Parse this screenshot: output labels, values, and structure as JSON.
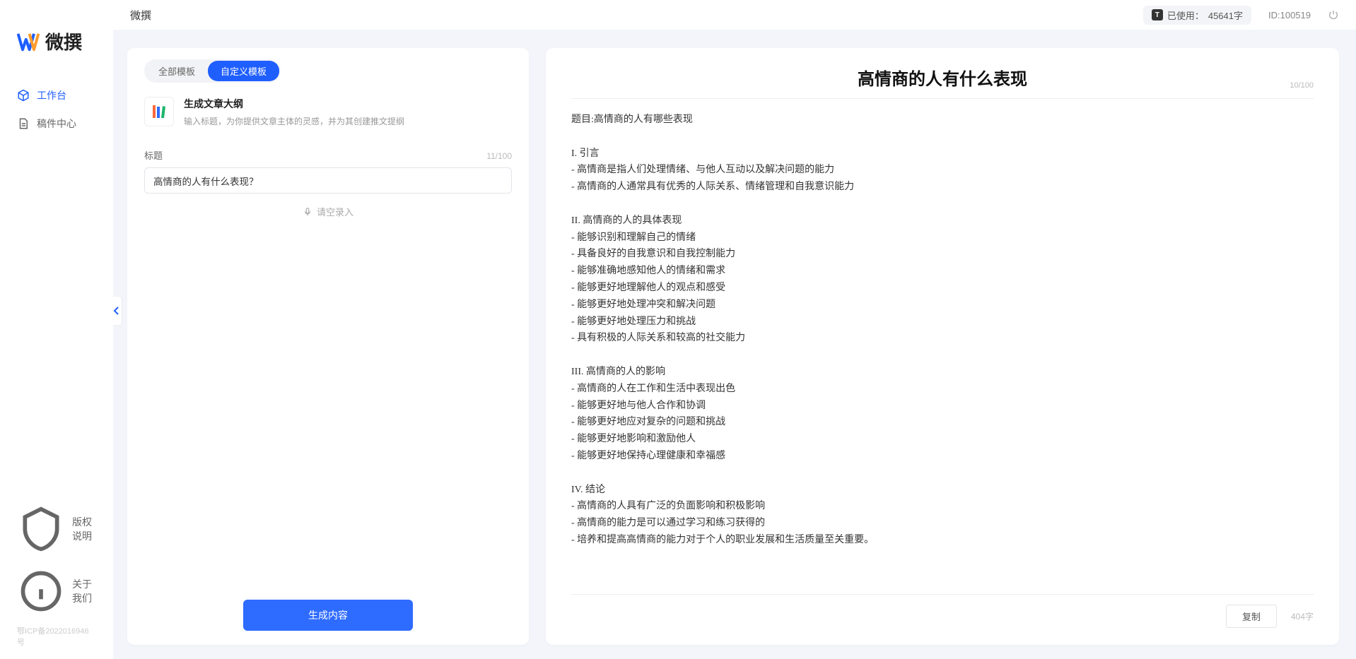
{
  "app": {
    "brand_text": "微撰",
    "icp": "鄂ICP备2022016946号"
  },
  "sidebar": {
    "items": [
      {
        "label": "工作台",
        "active": true
      },
      {
        "label": "稿件中心",
        "active": false
      }
    ],
    "footer": [
      {
        "label": "版权说明"
      },
      {
        "label": "关于我们"
      }
    ]
  },
  "topbar": {
    "title": "微撰",
    "usage_prefix": "已使用：",
    "usage_value": "45641字",
    "id_label": "ID:100519"
  },
  "left": {
    "tabs": [
      {
        "label": "全部模板",
        "active": false
      },
      {
        "label": "自定义模板",
        "active": true
      }
    ],
    "template": {
      "name": "生成文章大纲",
      "desc": "输入标题，为你提供文章主体的灵感，并为其创建推文提纲"
    },
    "field_label": "标题",
    "title_counter": "11/100",
    "title_value": "高情商的人有什么表现？",
    "voice_hint": "请空录入",
    "generate_label": "生成内容"
  },
  "right": {
    "title": "高情商的人有什么表现",
    "title_counter": "10/100",
    "body": "题目:高情商的人有哪些表现\n\nI. 引言\n- 高情商是指人们处理情绪、与他人互动以及解决问题的能力\n- 高情商的人通常具有优秀的人际关系、情绪管理和自我意识能力\n\nII. 高情商的人的具体表现\n- 能够识别和理解自己的情绪\n- 具备良好的自我意识和自我控制能力\n- 能够准确地感知他人的情绪和需求\n- 能够更好地理解他人的观点和感受\n- 能够更好地处理冲突和解决问题\n- 能够更好地处理压力和挑战\n- 具有积极的人际关系和较高的社交能力\n\nIII. 高情商的人的影响\n- 高情商的人在工作和生活中表现出色\n- 能够更好地与他人合作和协调\n- 能够更好地应对复杂的问题和挑战\n- 能够更好地影响和激励他人\n- 能够更好地保持心理健康和幸福感\n\nIV. 结论\n- 高情商的人具有广泛的负面影响和积极影响\n- 高情商的能力是可以通过学习和练习获得的\n- 培养和提高高情商的能力对于个人的职业发展和生活质量至关重要。",
    "copy_label": "复制",
    "word_count": "404字"
  }
}
